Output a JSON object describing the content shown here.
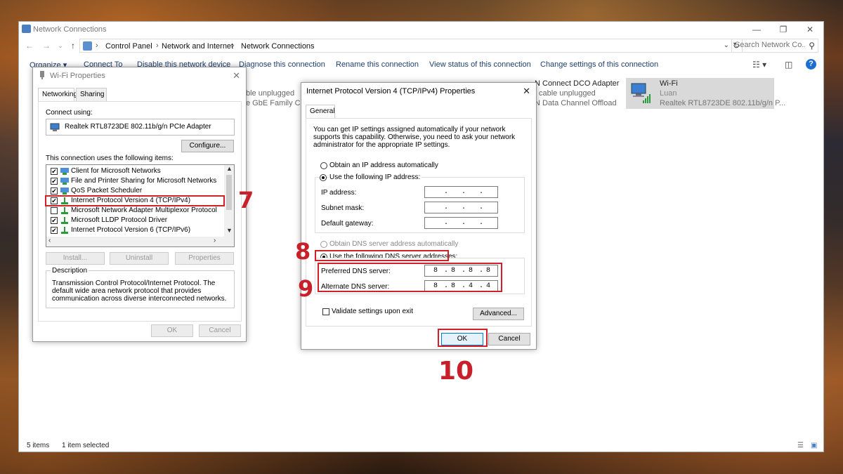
{
  "explorer": {
    "title": "Network Connections",
    "breadcrumb": [
      "Control Panel",
      "Network and Internet",
      "Network Connections"
    ],
    "search_placeholder": "Search Network Co...",
    "commands": {
      "organize": "Organize ▾",
      "connect_to": "Connect To",
      "disable": "Disable this network device",
      "diagnose": "Diagnose this connection",
      "rename": "Rename this connection",
      "view_status": "View status of this connection",
      "change_settings": "Change settings of this connection"
    },
    "adapters": {
      "ethernet_status": "ble unplugged",
      "ethernet_desc": "e GbE Family Con",
      "vpn_title": "N Connect DCO Adapter",
      "vpn_status": "cable unplugged",
      "vpn_desc": "N Data Channel Offload",
      "wifi_title": "Wi-Fi",
      "wifi_network": "Luan",
      "wifi_desc": "Realtek RTL8723DE 802.11b/g/n P..."
    },
    "status": {
      "items": "5 items",
      "selected": "1 item selected"
    }
  },
  "wifi_props": {
    "title": "Wi-Fi Properties",
    "tabs": [
      "Networking",
      "Sharing"
    ],
    "connect_using_label": "Connect using:",
    "adapter_name": "Realtek RTL8723DE 802.11b/g/n PCIe Adapter",
    "configure_label": "Configure...",
    "items_label": "This connection uses the following items:",
    "items": [
      {
        "label": "Client for Microsoft Networks",
        "checked": true
      },
      {
        "label": "File and Printer Sharing for Microsoft Networks",
        "checked": true
      },
      {
        "label": "QoS Packet Scheduler",
        "checked": true
      },
      {
        "label": "Internet Protocol Version 4 (TCP/IPv4)",
        "checked": true
      },
      {
        "label": "Microsoft Network Adapter Multiplexor Protocol",
        "checked": false
      },
      {
        "label": "Microsoft LLDP Protocol Driver",
        "checked": true
      },
      {
        "label": "Internet Protocol Version 6 (TCP/IPv6)",
        "checked": true
      }
    ],
    "install_label": "Install...",
    "uninstall_label": "Uninstall",
    "properties_label": "Properties",
    "description_label": "Description",
    "description_text": "Transmission Control Protocol/Internet Protocol. The default wide area network protocol that provides communication across diverse interconnected networks.",
    "ok_label": "OK",
    "cancel_label": "Cancel"
  },
  "ipv4_props": {
    "title": "Internet Protocol Version 4 (TCP/IPv4) Properties",
    "tab": "General",
    "intro": "You can get IP settings assigned automatically if your network supports this capability. Otherwise, you need to ask your network administrator for the appropriate IP settings.",
    "obtain_ip_auto": "Obtain an IP address automatically",
    "use_following_ip": "Use the following IP address:",
    "ip_address_label": "IP address:",
    "subnet_mask_label": "Subnet mask:",
    "default_gateway_label": "Default gateway:",
    "obtain_dns_auto": "Obtain DNS server address automatically",
    "use_following_dns": "Use the following DNS server addresses:",
    "preferred_dns_label": "Preferred DNS server:",
    "preferred_dns": [
      "8",
      "8",
      "8",
      "8"
    ],
    "alternate_dns_label": "Alternate DNS server:",
    "alternate_dns": [
      "8",
      "8",
      "4",
      "4"
    ],
    "validate_label": "Validate settings upon exit",
    "advanced_label": "Advanced...",
    "ok_label": "OK",
    "cancel_label": "Cancel"
  },
  "annotations": {
    "step7": "7",
    "step8": "8",
    "step9": "9",
    "step10": "10",
    "highlight_color": "#d0202a"
  }
}
